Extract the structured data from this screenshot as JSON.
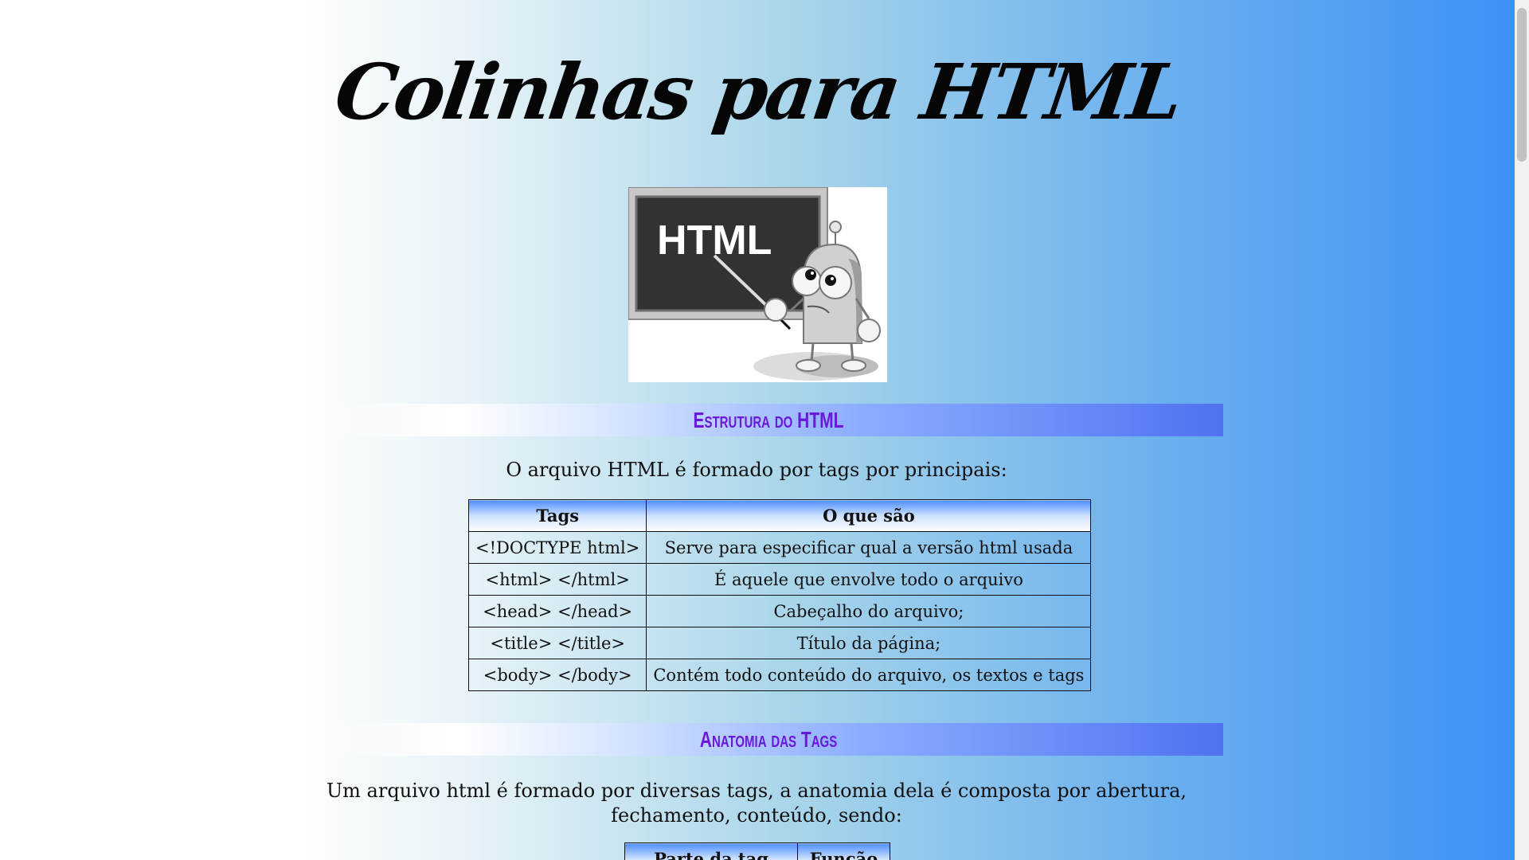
{
  "page": {
    "title": "Colinhas para HTML",
    "hero_image_alt": "",
    "hero_image": {
      "board_text": "HTML",
      "illustration": "cartoon-robot-teacher"
    }
  },
  "sections": [
    {
      "heading": "Estrutura do HTML",
      "text": "O arquivo HTML é formado por tags por principais:",
      "table": {
        "headers": [
          "Tags",
          "O que são"
        ],
        "rows": [
          [
            "<!DOCTYPE html>",
            "Serve para especificar qual a versão html usada"
          ],
          [
            "<html> </html>",
            "É aquele que envolve todo o arquivo"
          ],
          [
            "<head> </head>",
            "Cabeçalho do arquivo;"
          ],
          [
            "<title> </title>",
            "Título da página;"
          ],
          [
            "<body> </body>",
            "Contém todo conteúdo do arquivo, os textos e tags"
          ]
        ]
      }
    },
    {
      "heading": "Anatomia das Tags",
      "text": "Um arquivo html é formado por diversas tags, a anatomia dela é composta por abertura, fechamento, conteúdo, sendo:",
      "table": {
        "headers": [
          "Parte da tag",
          "Função"
        ],
        "rows": []
      }
    }
  ],
  "colors": {
    "heading": "#6a19dc",
    "gradient_left": "#ffffff",
    "gradient_right": "#3b8ff6",
    "table_header_top": "#4d8fff"
  },
  "scrollbar": {
    "position": "top"
  }
}
